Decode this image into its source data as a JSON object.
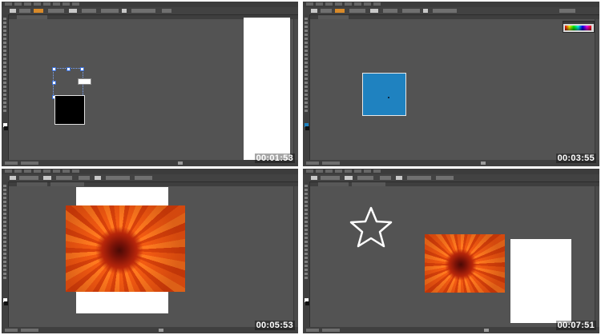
{
  "colors": {
    "workspace_bg": "#535353",
    "toolbar_bg": "#404040",
    "accent_blue": "#1f82c0",
    "flower_orange": "#e04a10"
  },
  "panels": [
    {
      "label": "Illustrator workspace - selection of black rectangle",
      "timestamp": "00:01:53"
    },
    {
      "label": "Illustrator workspace - blue square with color spectrum",
      "timestamp": "00:03:55"
    },
    {
      "label": "Illustrator workspace - placed flower image over artboard",
      "timestamp": "00:05:53"
    },
    {
      "label": "Illustrator workspace - star shape and flower image",
      "timestamp": "00:07:51"
    }
  ],
  "icons": {
    "tools": "toolbox-icons",
    "star": "star-outline-shape",
    "flower": "flower-photo"
  }
}
